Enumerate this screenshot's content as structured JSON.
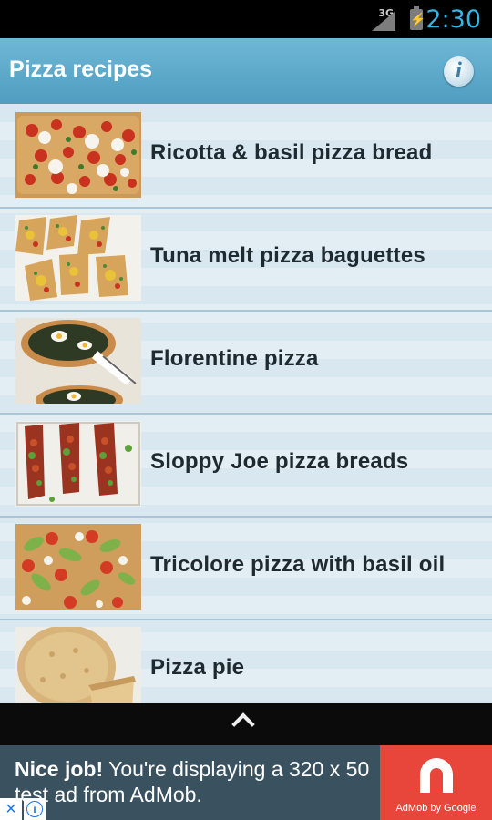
{
  "status_bar": {
    "network": "3G",
    "battery_glyph": "⚡",
    "time": "2:30"
  },
  "action_bar": {
    "title": "Pizza recipes",
    "info_icon_glyph": "i"
  },
  "recipes": [
    {
      "title": "Ricotta & basil pizza bread"
    },
    {
      "title": "Tuna melt pizza baguettes"
    },
    {
      "title": "Florentine pizza"
    },
    {
      "title": "Sloppy Joe pizza breads"
    },
    {
      "title": "Tricolore pizza with basil oil"
    },
    {
      "title": "Pizza pie"
    }
  ],
  "ad": {
    "headline": "Nice job!",
    "body": " You're displaying a 320 x 50 test ad from AdMob.",
    "brand_caption": "AdMob by Google",
    "close_glyph": "×",
    "info_glyph": "i"
  },
  "colors": {
    "accent": "#33b5e5",
    "action_bar": "#5aa6c8",
    "ad_brand": "#e8463b"
  }
}
